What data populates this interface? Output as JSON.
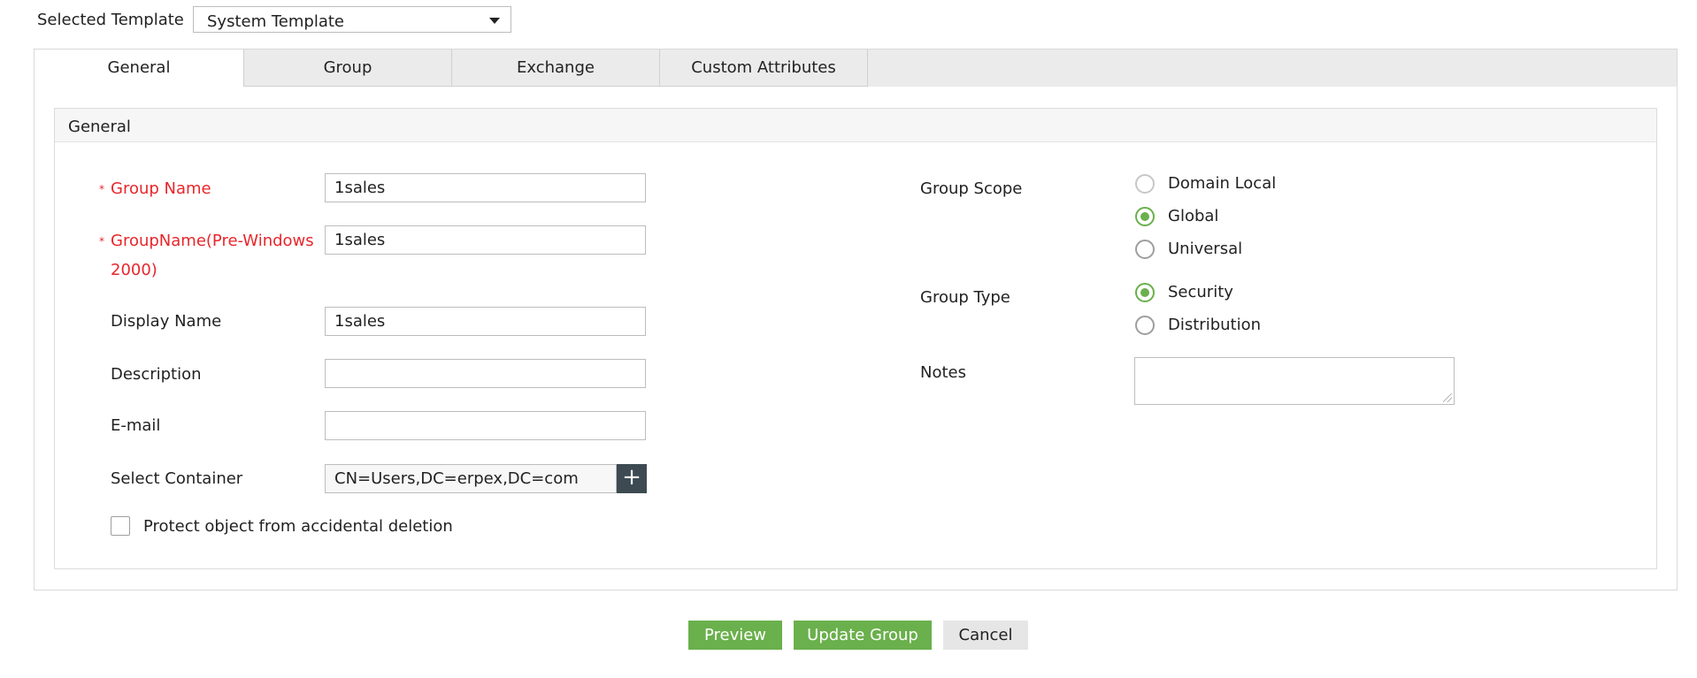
{
  "template": {
    "label": "Selected Template",
    "selected": "System Template"
  },
  "tabs": [
    {
      "label": "General",
      "active": true
    },
    {
      "label": "Group",
      "active": false
    },
    {
      "label": "Exchange",
      "active": false
    },
    {
      "label": "Custom Attributes",
      "active": false
    }
  ],
  "section": {
    "title": "General"
  },
  "form": {
    "required_marker": "*",
    "group_name": {
      "label": "Group Name",
      "value": "1sales"
    },
    "group_name_pre2000": {
      "label_line1": "GroupName(Pre-Windows",
      "label_line2": "2000)",
      "value": "1sales"
    },
    "display_name": {
      "label": "Display Name",
      "value": "1sales"
    },
    "description": {
      "label": "Description",
      "value": ""
    },
    "email": {
      "label": "E-mail",
      "value": ""
    },
    "container": {
      "label": "Select Container",
      "value": "CN=Users,DC=erpex,DC=com",
      "add_icon": "plus-icon",
      "add_glyph": "+"
    },
    "protect": {
      "label": "Protect object from accidental deletion",
      "checked": false
    }
  },
  "scope": {
    "label": "Group Scope",
    "options": [
      {
        "label": "Domain Local",
        "selected": false,
        "disabled": true
      },
      {
        "label": "Global",
        "selected": true,
        "disabled": false
      },
      {
        "label": "Universal",
        "selected": false,
        "disabled": false
      }
    ]
  },
  "type": {
    "label": "Group Type",
    "options": [
      {
        "label": "Security",
        "selected": true
      },
      {
        "label": "Distribution",
        "selected": false
      }
    ]
  },
  "notes": {
    "label": "Notes",
    "value": ""
  },
  "buttons": {
    "preview": "Preview",
    "update": "Update Group",
    "cancel": "Cancel"
  },
  "colors": {
    "accent": "#6ab04c",
    "required": "#e8262b",
    "dark_button": "#3d4a52"
  }
}
